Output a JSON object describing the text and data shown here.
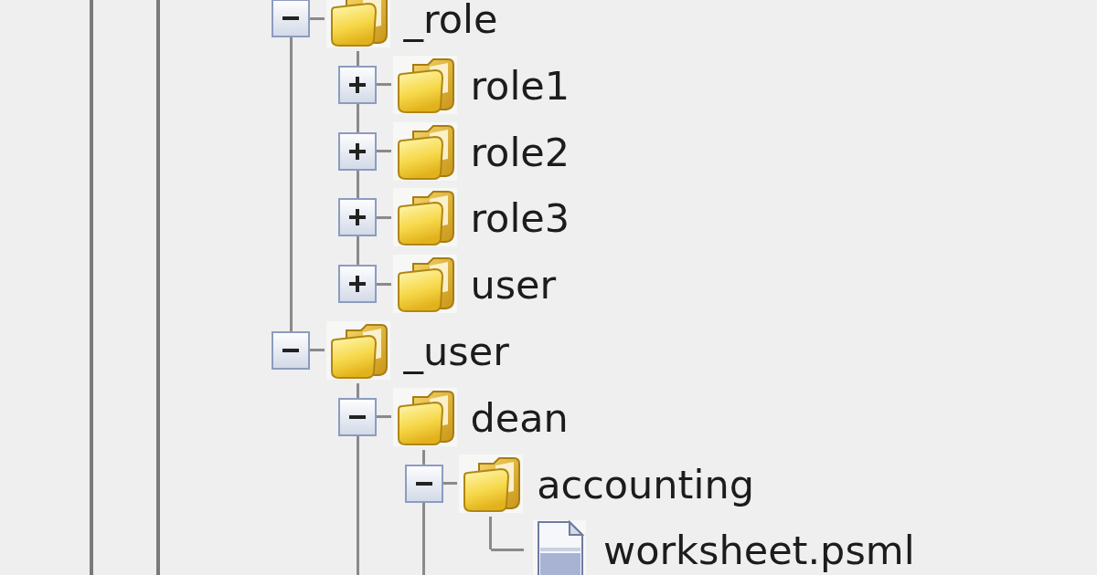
{
  "tree": {
    "nodes": [
      {
        "kind": "folder",
        "name": "_role",
        "expanded": true,
        "children": [
          {
            "kind": "folder",
            "name": "role1",
            "expanded": false
          },
          {
            "kind": "folder",
            "name": "role2",
            "expanded": false
          },
          {
            "kind": "folder",
            "name": "role3",
            "expanded": false
          },
          {
            "kind": "folder",
            "name": "user",
            "expanded": false,
            "continues": false
          }
        ]
      },
      {
        "kind": "folder",
        "name": "_user",
        "expanded": true,
        "continues": false,
        "children": [
          {
            "kind": "folder",
            "name": "dean",
            "expanded": true,
            "continues": true,
            "children": [
              {
                "kind": "folder",
                "name": "accounting",
                "expanded": true,
                "continues": true,
                "children": [
                  {
                    "kind": "file",
                    "name": "worksheet.psml",
                    "continues": false
                  }
                ]
              }
            ]
          }
        ]
      }
    ]
  }
}
